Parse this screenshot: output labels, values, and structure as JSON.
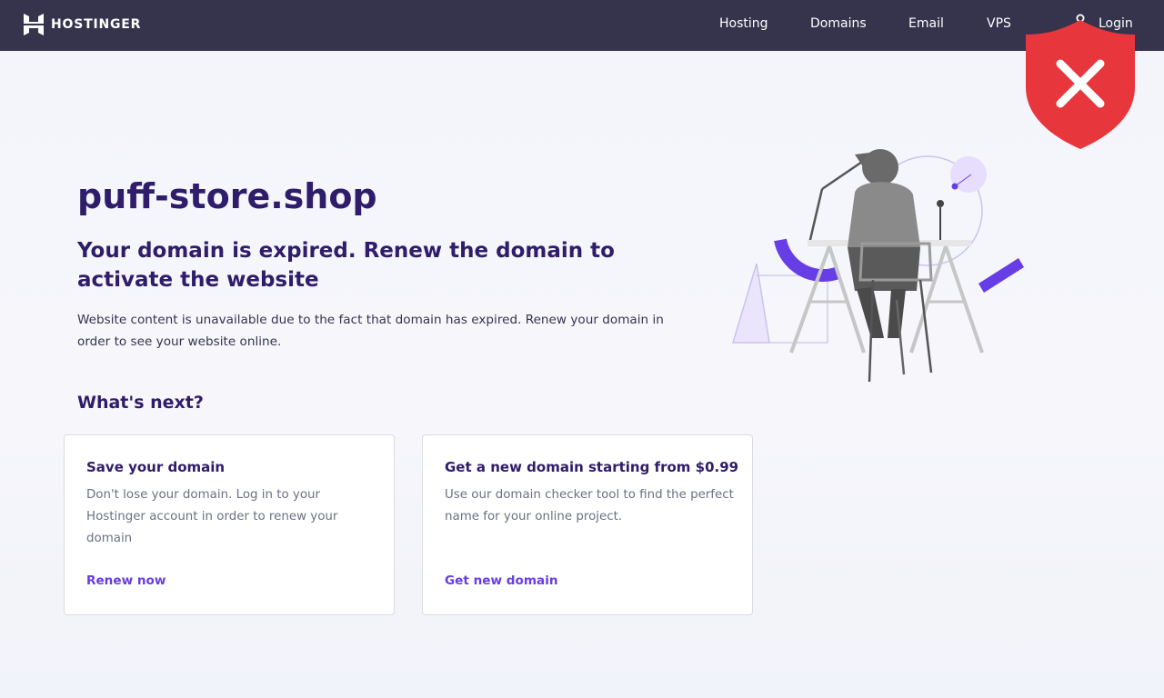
{
  "header": {
    "brand": "HOSTINGER",
    "nav": [
      {
        "label": "Hosting"
      },
      {
        "label": "Domains"
      },
      {
        "label": "Email"
      },
      {
        "label": "VPS"
      },
      {
        "label": "Login"
      }
    ]
  },
  "main": {
    "domain": "puff-store.shop",
    "headline": "Your domain is expired. Renew the domain to activate the website",
    "description": "Website content is unavailable due to the fact that domain has expired. Renew your domain in order to see your website online.",
    "whats_next": "What's next?",
    "cards": [
      {
        "title": "Save your domain",
        "text": "Don't lose your domain. Log in to your Hostinger account in order to renew your domain",
        "link": "Renew now"
      },
      {
        "title": "Get a new domain starting from $0.99",
        "text": "Use our domain checker tool to find the perfect name for your online project.",
        "link": "Get new domain"
      }
    ]
  },
  "colors": {
    "header_bg": "#36344d",
    "heading": "#2f1c6a",
    "link": "#673de6",
    "shield": "#e8363d"
  },
  "icons": [
    "hostinger-logo-icon",
    "user-icon",
    "security-shield-icon",
    "close-icon"
  ]
}
